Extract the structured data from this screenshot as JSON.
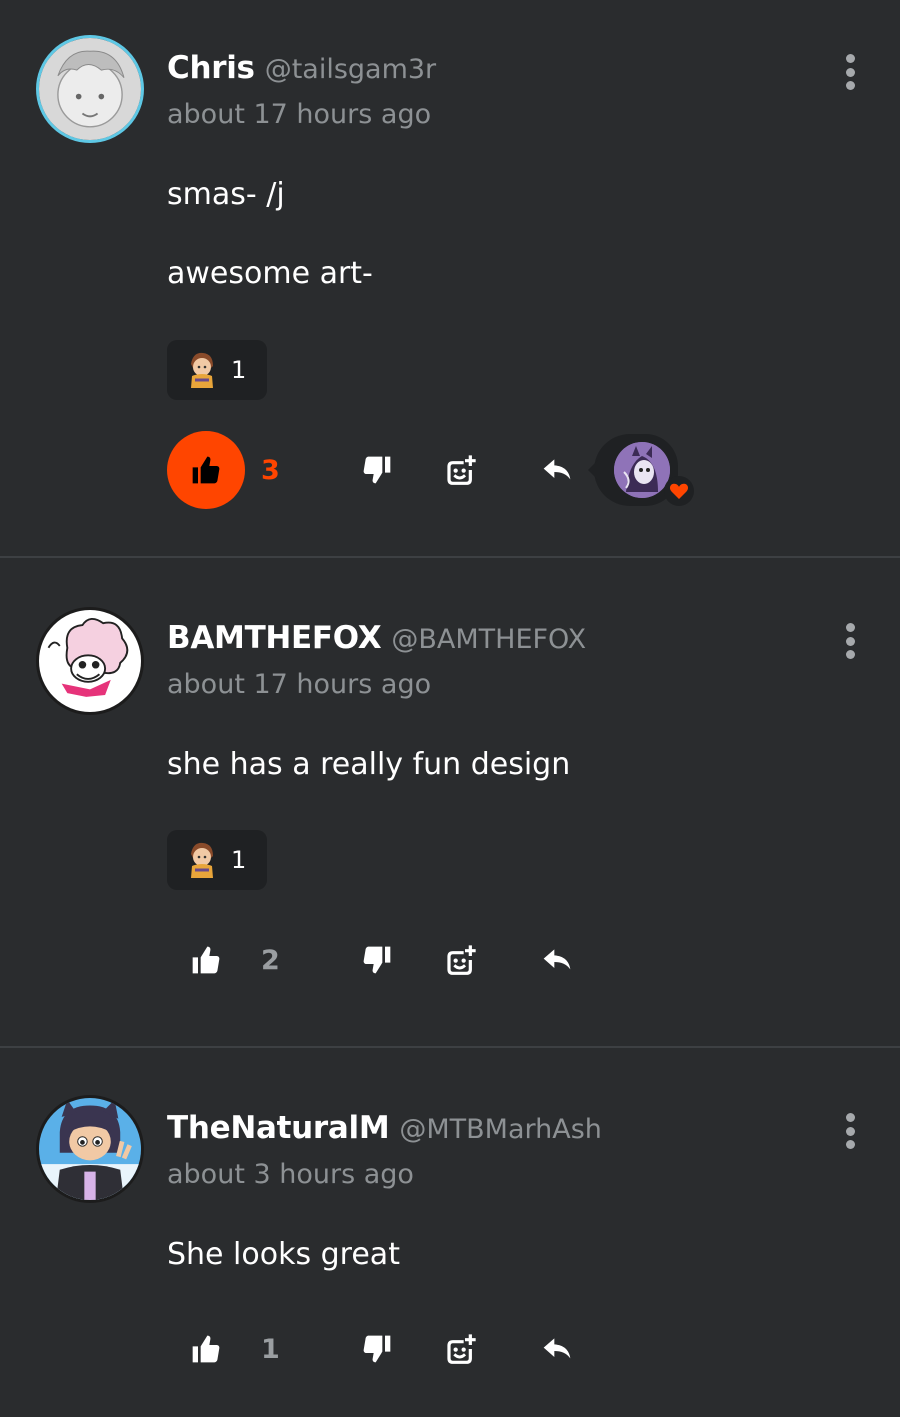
{
  "colors": {
    "background": "#2a2c2e",
    "accent": "#ff4500",
    "muted_text": "#8d9194",
    "chip_bg": "#1f2123"
  },
  "comments": [
    {
      "display_name": "Chris",
      "handle": "@tailsgam3r",
      "timestamp": "about 17 hours ago",
      "paragraphs": [
        "smas- /j",
        "awesome art-"
      ],
      "reaction": {
        "icon": "character-sticker-icon",
        "count": "1"
      },
      "likes": "3",
      "liked": true,
      "has_reply_preview": true
    },
    {
      "display_name": "BAMTHEFOX",
      "handle": "@BAMTHEFOX",
      "timestamp": "about 17 hours ago",
      "paragraphs": [
        "she has a really fun design"
      ],
      "reaction": {
        "icon": "character-sticker-icon",
        "count": "1"
      },
      "likes": "2",
      "liked": false
    },
    {
      "display_name": "TheNaturalM",
      "handle": "@MTBMarhAsh",
      "timestamp": "about 3 hours ago",
      "paragraphs": [
        "She looks great"
      ],
      "likes": "1",
      "liked": false
    }
  ]
}
